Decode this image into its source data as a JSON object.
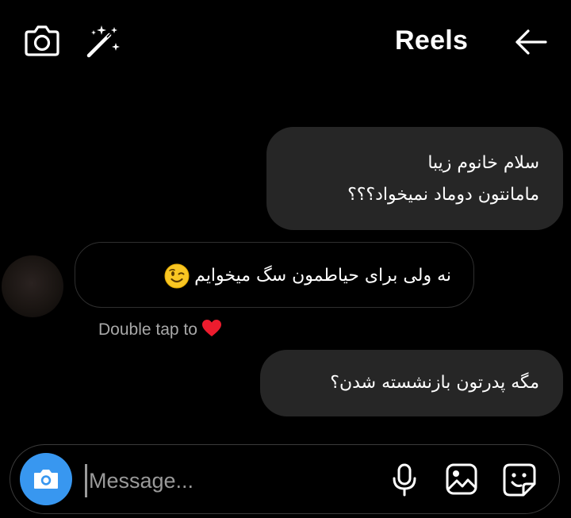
{
  "header": {
    "title": "Reels",
    "icons": {
      "camera": "camera-icon",
      "effects": "magic-wand-icon",
      "back": "arrow-right-icon"
    }
  },
  "messages": [
    {
      "direction": "sent",
      "lines": [
        "سلام خانوم زیبا",
        "مامانتون دوماد نمیخواد؟؟؟"
      ]
    },
    {
      "direction": "received",
      "text": "نه ولی برای حیاطمون سگ میخوایم",
      "emoji": "winking-face"
    },
    {
      "direction": "sent",
      "text": "مگه پدرتون بازنشسته شدن؟"
    }
  ],
  "reaction_hint": {
    "text": "Double tap to",
    "icon": "heart"
  },
  "composer": {
    "placeholder": "Message...",
    "value": "",
    "accent_color": "#3897f0",
    "icons": [
      "camera-icon",
      "microphone-icon",
      "gallery-icon",
      "sticker-icon"
    ]
  }
}
